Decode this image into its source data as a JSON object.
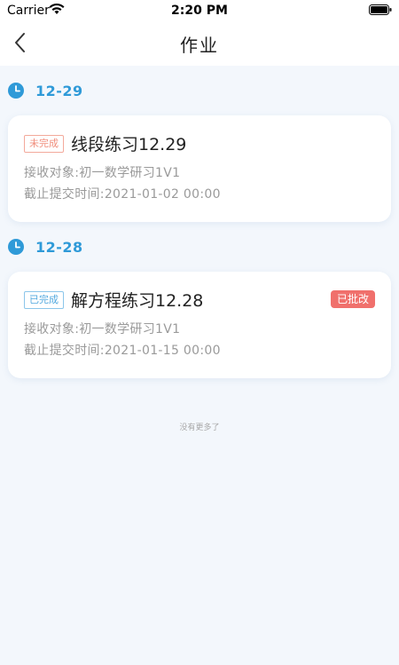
{
  "status_bar": {
    "carrier": "Carrier",
    "time": "2:20 PM"
  },
  "nav": {
    "title": "作业",
    "back_icon": "chevron-left-icon"
  },
  "groups": [
    {
      "date": "12-29",
      "icon": "clock-icon",
      "homework": {
        "status": "未完成",
        "title": "线段练习12.29",
        "recipient": "接收对象:初一数学研习1V1",
        "deadline": "截止提交时间:2021-01-02 00:00",
        "badge": ""
      }
    },
    {
      "date": "12-28",
      "icon": "clock-icon",
      "homework": {
        "status": "已完成",
        "title": "解方程练习12.28",
        "recipient": "接收对象:初一数学研习1V1",
        "deadline": "截止提交时间:2021-01-15 00:00",
        "badge": "已批改"
      }
    }
  ],
  "footer": {
    "no_more": "没有更多了"
  },
  "colors": {
    "accent": "#2f9ad8",
    "incomplete": "#f08d7b",
    "complete": "#53a9df",
    "graded_badge": "#f0706c",
    "background": "#f3f7fc"
  }
}
